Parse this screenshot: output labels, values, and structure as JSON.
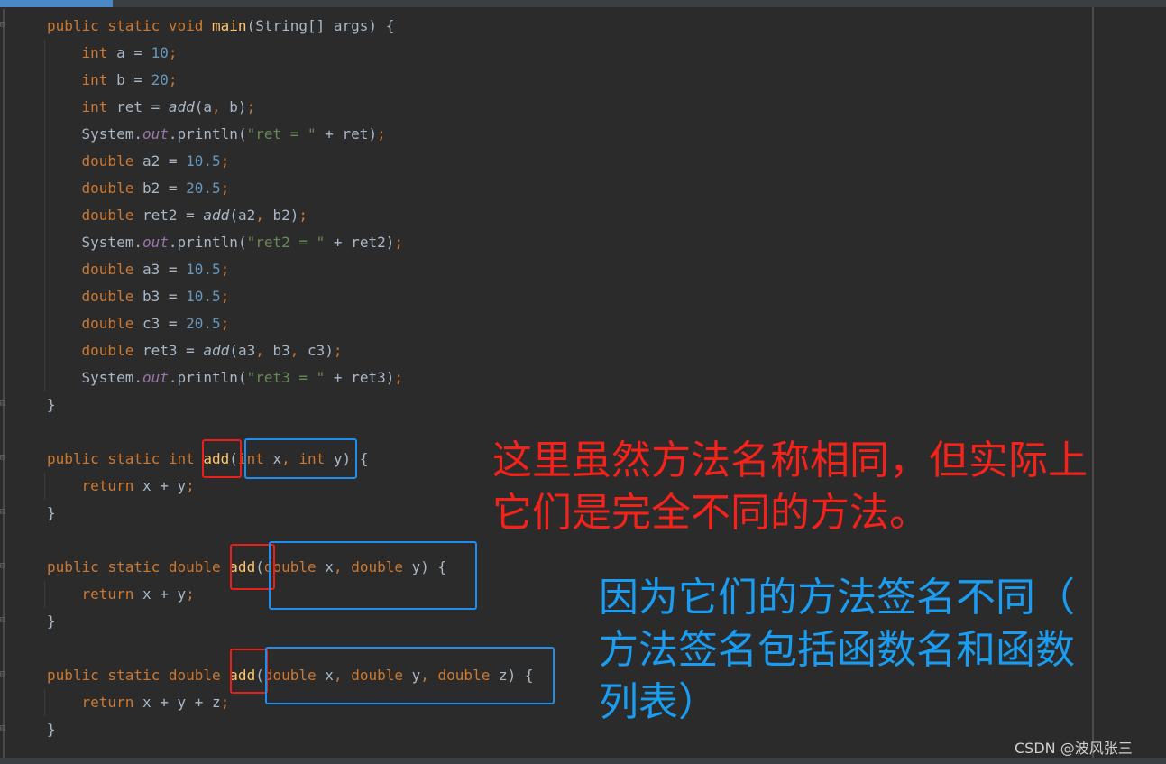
{
  "editor": {
    "lines": [
      {
        "tokens": [
          {
            "t": "public static void ",
            "c": "kw"
          },
          {
            "t": "main",
            "c": "fn"
          },
          {
            "t": "(String[] args) {",
            "c": ""
          }
        ]
      },
      {
        "tokens": [
          {
            "t": "    int ",
            "c": "kw"
          },
          {
            "t": "a = ",
            "c": ""
          },
          {
            "t": "10",
            "c": "num"
          },
          {
            "t": ";",
            "c": "semi"
          }
        ]
      },
      {
        "tokens": [
          {
            "t": "    int ",
            "c": "kw"
          },
          {
            "t": "b = ",
            "c": ""
          },
          {
            "t": "20",
            "c": "num"
          },
          {
            "t": ";",
            "c": "semi"
          }
        ]
      },
      {
        "tokens": [
          {
            "t": "    int ",
            "c": "kw"
          },
          {
            "t": "ret = ",
            "c": ""
          },
          {
            "t": "add",
            "c": "call"
          },
          {
            "t": "(a",
            "c": ""
          },
          {
            "t": ", ",
            "c": "semi"
          },
          {
            "t": "b)",
            "c": ""
          },
          {
            "t": ";",
            "c": "semi"
          }
        ]
      },
      {
        "tokens": [
          {
            "t": "    System.",
            "c": ""
          },
          {
            "t": "out",
            "c": "field"
          },
          {
            "t": ".println(",
            "c": ""
          },
          {
            "t": "\"ret = \"",
            "c": "str"
          },
          {
            "t": " + ret)",
            "c": ""
          },
          {
            "t": ";",
            "c": "semi"
          }
        ]
      },
      {
        "tokens": [
          {
            "t": "    double ",
            "c": "kw"
          },
          {
            "t": "a2 = ",
            "c": ""
          },
          {
            "t": "10.5",
            "c": "num"
          },
          {
            "t": ";",
            "c": "semi"
          }
        ]
      },
      {
        "tokens": [
          {
            "t": "    double ",
            "c": "kw"
          },
          {
            "t": "b2 = ",
            "c": ""
          },
          {
            "t": "20.5",
            "c": "num"
          },
          {
            "t": ";",
            "c": "semi"
          }
        ]
      },
      {
        "tokens": [
          {
            "t": "    double ",
            "c": "kw"
          },
          {
            "t": "ret2 = ",
            "c": ""
          },
          {
            "t": "add",
            "c": "call"
          },
          {
            "t": "(a2",
            "c": ""
          },
          {
            "t": ", ",
            "c": "semi"
          },
          {
            "t": "b2)",
            "c": ""
          },
          {
            "t": ";",
            "c": "semi"
          }
        ]
      },
      {
        "tokens": [
          {
            "t": "    System.",
            "c": ""
          },
          {
            "t": "out",
            "c": "field"
          },
          {
            "t": ".println(",
            "c": ""
          },
          {
            "t": "\"ret2 = \"",
            "c": "str"
          },
          {
            "t": " + ret2)",
            "c": ""
          },
          {
            "t": ";",
            "c": "semi"
          }
        ]
      },
      {
        "tokens": [
          {
            "t": "    double ",
            "c": "kw"
          },
          {
            "t": "a3 = ",
            "c": ""
          },
          {
            "t": "10.5",
            "c": "num"
          },
          {
            "t": ";",
            "c": "semi"
          }
        ]
      },
      {
        "tokens": [
          {
            "t": "    double ",
            "c": "kw"
          },
          {
            "t": "b3 = ",
            "c": ""
          },
          {
            "t": "10.5",
            "c": "num"
          },
          {
            "t": ";",
            "c": "semi"
          }
        ]
      },
      {
        "tokens": [
          {
            "t": "    double ",
            "c": "kw"
          },
          {
            "t": "c3 = ",
            "c": ""
          },
          {
            "t": "20.5",
            "c": "num"
          },
          {
            "t": ";",
            "c": "semi"
          }
        ]
      },
      {
        "tokens": [
          {
            "t": "    double ",
            "c": "kw"
          },
          {
            "t": "ret3 = ",
            "c": ""
          },
          {
            "t": "add",
            "c": "call"
          },
          {
            "t": "(a3",
            "c": ""
          },
          {
            "t": ", ",
            "c": "semi"
          },
          {
            "t": "b3",
            "c": ""
          },
          {
            "t": ", ",
            "c": "semi"
          },
          {
            "t": "c3)",
            "c": ""
          },
          {
            "t": ";",
            "c": "semi"
          }
        ]
      },
      {
        "tokens": [
          {
            "t": "    System.",
            "c": ""
          },
          {
            "t": "out",
            "c": "field"
          },
          {
            "t": ".println(",
            "c": ""
          },
          {
            "t": "\"ret3 = \"",
            "c": "str"
          },
          {
            "t": " + ret3)",
            "c": ""
          },
          {
            "t": ";",
            "c": "semi"
          }
        ]
      },
      {
        "tokens": [
          {
            "t": "}",
            "c": ""
          }
        ]
      },
      {
        "tokens": []
      },
      {
        "tokens": [
          {
            "t": "public static int ",
            "c": "kw"
          },
          {
            "t": "add",
            "c": "fn"
          },
          {
            "t": "(",
            "c": ""
          },
          {
            "t": "int ",
            "c": "kw"
          },
          {
            "t": "x",
            "c": ""
          },
          {
            "t": ", ",
            "c": "semi"
          },
          {
            "t": "int ",
            "c": "kw"
          },
          {
            "t": "y) {",
            "c": ""
          }
        ]
      },
      {
        "tokens": [
          {
            "t": "    return ",
            "c": "kw"
          },
          {
            "t": "x + y",
            "c": ""
          },
          {
            "t": ";",
            "c": "semi"
          }
        ]
      },
      {
        "tokens": [
          {
            "t": "}",
            "c": ""
          }
        ]
      },
      {
        "tokens": []
      },
      {
        "tokens": [
          {
            "t": "public static double ",
            "c": "kw"
          },
          {
            "t": "add",
            "c": "fn"
          },
          {
            "t": "(",
            "c": ""
          },
          {
            "t": "double ",
            "c": "kw"
          },
          {
            "t": "x",
            "c": ""
          },
          {
            "t": ", ",
            "c": "semi"
          },
          {
            "t": "double ",
            "c": "kw"
          },
          {
            "t": "y) {",
            "c": ""
          }
        ]
      },
      {
        "tokens": [
          {
            "t": "    return ",
            "c": "kw"
          },
          {
            "t": "x + y",
            "c": ""
          },
          {
            "t": ";",
            "c": "semi"
          }
        ]
      },
      {
        "tokens": [
          {
            "t": "}",
            "c": ""
          }
        ]
      },
      {
        "tokens": []
      },
      {
        "tokens": [
          {
            "t": "public static double ",
            "c": "kw"
          },
          {
            "t": "add",
            "c": "fn"
          },
          {
            "t": "(",
            "c": ""
          },
          {
            "t": "double ",
            "c": "kw"
          },
          {
            "t": "x",
            "c": ""
          },
          {
            "t": ", ",
            "c": "semi"
          },
          {
            "t": "double ",
            "c": "kw"
          },
          {
            "t": "y",
            "c": ""
          },
          {
            "t": ", ",
            "c": "semi"
          },
          {
            "t": "double ",
            "c": "kw"
          },
          {
            "t": "z) {",
            "c": ""
          }
        ]
      },
      {
        "tokens": [
          {
            "t": "    return ",
            "c": "kw"
          },
          {
            "t": "x + y + z",
            "c": ""
          },
          {
            "t": ";",
            "c": "semi"
          }
        ]
      },
      {
        "tokens": [
          {
            "t": "}",
            "c": ""
          }
        ]
      }
    ]
  },
  "annotations": {
    "red_note": "这里虽然方法名称相同，但实际上\n它们是完全不同的方法。",
    "blue_note": "因为它们的方法签名不同（\n方法签名包括函数名和函数\n列表）"
  },
  "colors": {
    "keyword": "#cc7832",
    "function": "#ffc66d",
    "number": "#6897bb",
    "string": "#6a8759",
    "field": "#9876aa",
    "red_annotation": "#f3231b",
    "blue_annotation": "#1a9cf0"
  },
  "watermark": "CSDN @波风张三"
}
